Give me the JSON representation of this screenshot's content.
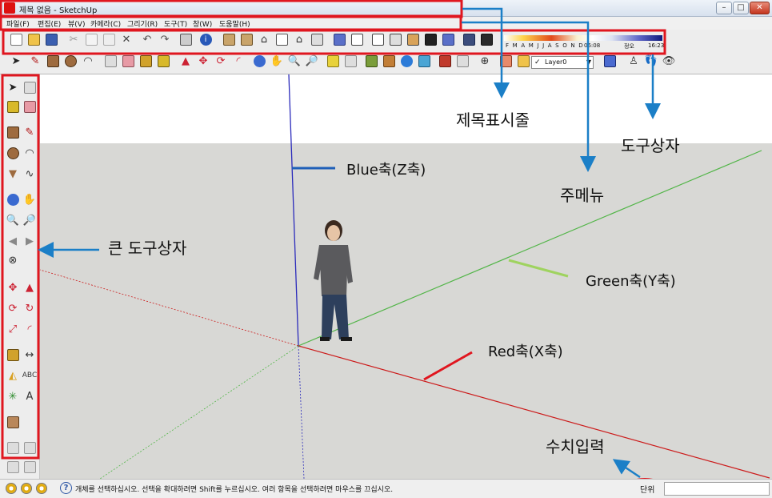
{
  "window": {
    "title": "제목 없음 - SketchUp",
    "controls": [
      "minimize",
      "maximize",
      "close"
    ]
  },
  "menu": {
    "items": [
      "파일(F)",
      "편집(E)",
      "뷰(V)",
      "카메라(C)",
      "그리기(R)",
      "도구(T)",
      "창(W)",
      "도움말(H)"
    ]
  },
  "toolbar": {
    "shadow_months": "F M A M J J A S O N D",
    "shadow_time_start": "06:08",
    "shadow_time_mid": "정오",
    "shadow_time_end": "16:23",
    "layer_name": "Layer0"
  },
  "status": {
    "message": "개체를 선택하십시오. 선택을 확대하려면 Shift를 누르십시오. 여러 항목을 선택하려면 마우스를 끄십시오.",
    "vcb_label": "단위",
    "vcb_value": ""
  },
  "annotations": {
    "title_bar": "제목표시줄",
    "toolbox": "도구상자",
    "main_menu": "주메뉴",
    "large_toolbox": "큰 도구상자",
    "blue_axis": "Blue축(Z축)",
    "green_axis": "Green축(Y축)",
    "red_axis": "Red축(X축)",
    "value_input": "수치입력"
  },
  "colors": {
    "highlight": "#e0161f",
    "arrow": "#1b7fc7",
    "axis_red": "#cc1b1b",
    "axis_green": "#52b548",
    "axis_blue": "#2b2bbb",
    "ground": "#d8d8d5"
  }
}
